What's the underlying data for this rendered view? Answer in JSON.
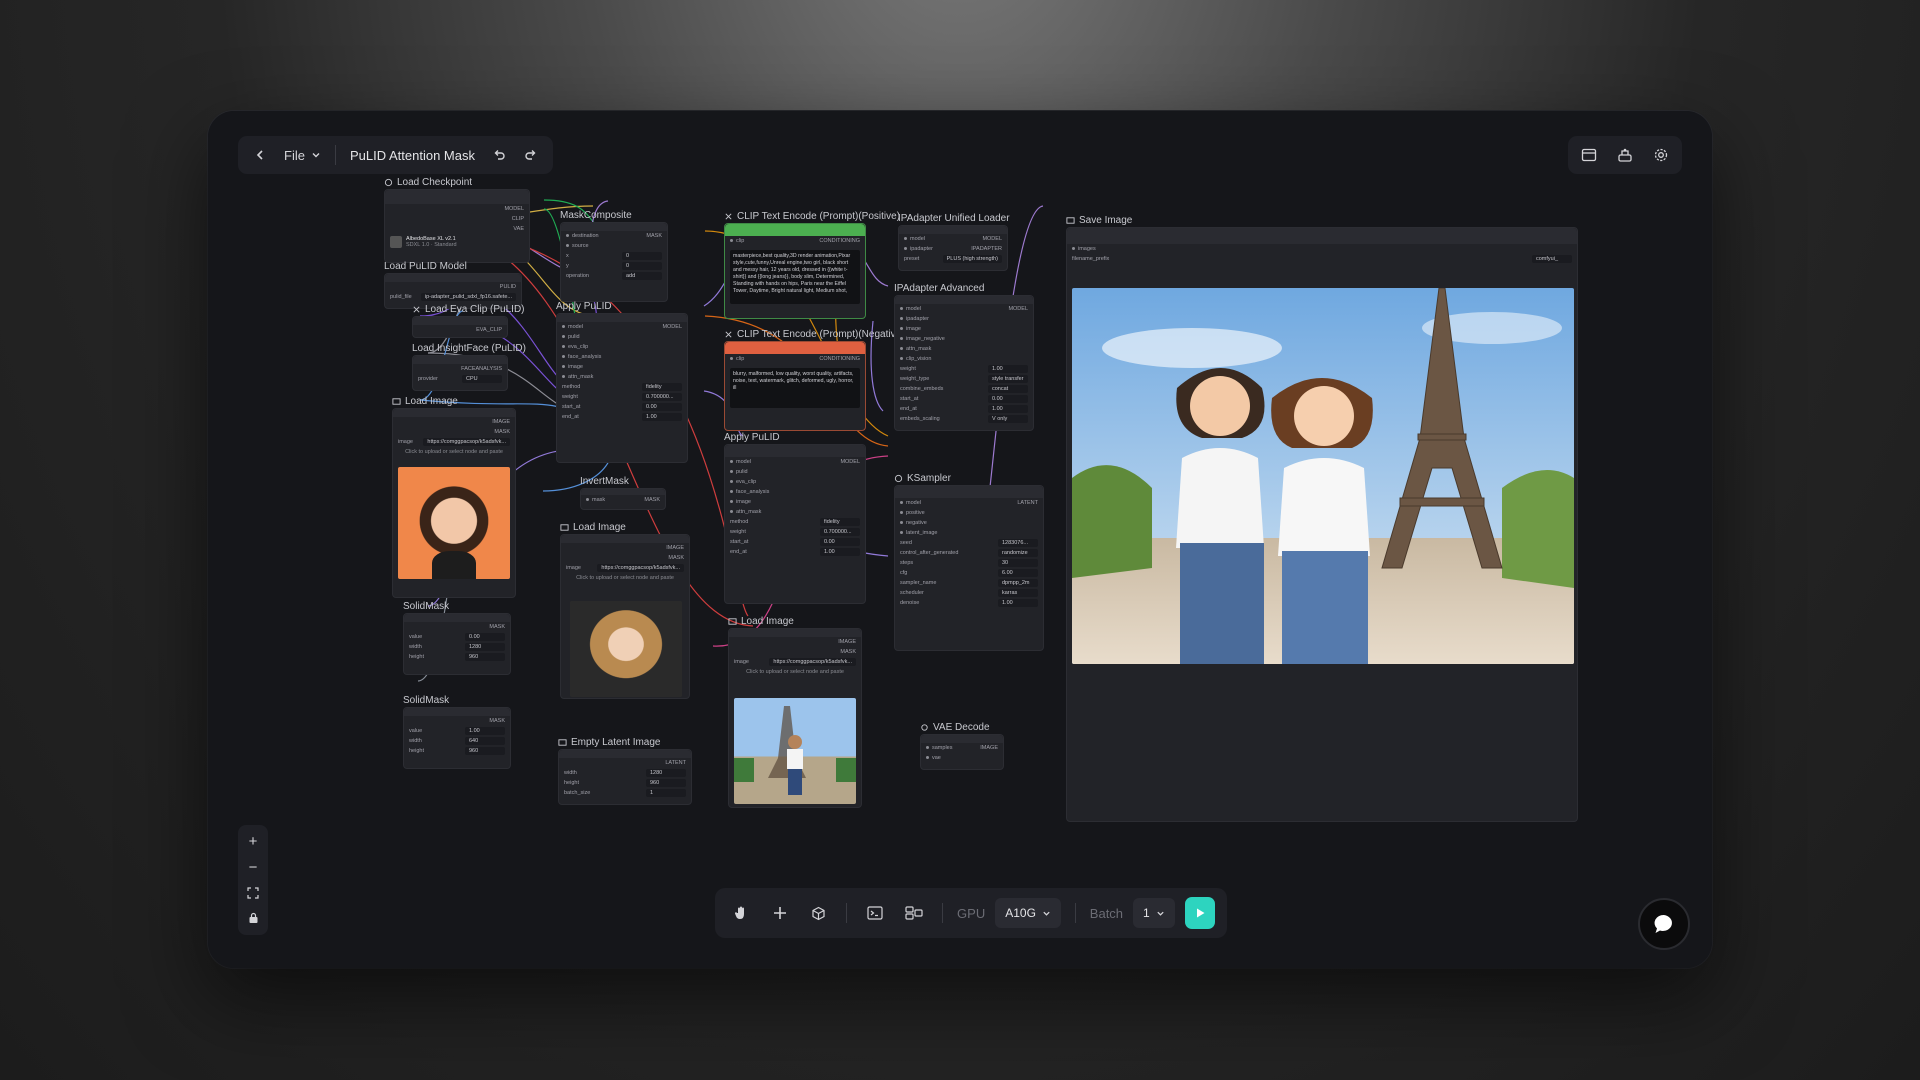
{
  "toolbar": {
    "back_icon": "chevron-left-icon",
    "file_label": "File",
    "workflow_title": "PuLID Attention Mask",
    "undo_icon": "undo-icon",
    "redo_icon": "redo-icon"
  },
  "top_right": {
    "icons": [
      "queue-icon",
      "workflow-icon",
      "settings-icon"
    ]
  },
  "zoom": {
    "zoom_in": "+",
    "zoom_out": "−"
  },
  "bottom_bar": {
    "gpu_label": "GPU",
    "gpu_value": "A10G",
    "batch_label": "Batch",
    "batch_value": "1"
  },
  "nodes": {
    "load_checkpoint": {
      "title": "Load Checkpoint",
      "out_model": "MODEL",
      "out_clip": "CLIP",
      "out_vae": "VAE",
      "ckpt": "AlbedoBase XL v2.1",
      "ckpt_sub": "SDXL 1.0 · Standard"
    },
    "load_pulid_model": {
      "title": "Load PuLID Model",
      "out": "PULID",
      "name_label": "pulid_file",
      "name_value": "ip-adapter_pulid_sdxl_fp16.safete..."
    },
    "load_eva_clip": {
      "title": "Load Eva Clip (PuLID)",
      "out": "EVA_CLIP"
    },
    "load_insightface": {
      "title": "Load InsightFace (PuLID)",
      "out": "FACEANALYSIS",
      "provider_label": "provider",
      "provider_value": "CPU"
    },
    "mask_composite": {
      "title": "MaskComposite",
      "in1": "destination",
      "in2": "source",
      "out": "MASK",
      "x_label": "x",
      "x_value": "0",
      "y_label": "y",
      "y_value": "0",
      "op_label": "operation",
      "op_value": "add"
    },
    "clip_pos": {
      "title": "CLIP Text Encode (Prompt)(Positive)",
      "in": "clip",
      "out": "CONDITIONING",
      "text": "masterpiece,best quality,3D render animation,Pixar style,cute,funny,Unreal engine,two girl, black short and messy hair, 12 years old, dressed in {{white t-shirt}} and {{long jeans}}, body slim, Determined, Standing with hands on hips, Paris near the Eiffel Tower, Daytime, Bright natural light, Medium shot,"
    },
    "clip_neg": {
      "title": "CLIP Text Encode (Prompt)(Negative)",
      "in": "clip",
      "out": "CONDITIONING",
      "text": "blurry, malformed, low quality, worst quality, artifacts, noise, text, watermark, glitch, deformed, ugly, horror, ill"
    },
    "ipadapter_loader": {
      "title": "IPAdapter Unified Loader",
      "in1": "model",
      "in2": "ipadapter",
      "out1": "MODEL",
      "out2": "IPADAPTER",
      "preset_label": "preset",
      "preset_value": "PLUS (high strength)"
    },
    "ipadapter_adv": {
      "title": "IPAdapter Advanced",
      "out": "MODEL",
      "inputs": [
        "model",
        "ipadapter",
        "image",
        "image_negative",
        "attn_mask",
        "clip_vision"
      ],
      "w": [
        [
          "weight",
          "1.00"
        ],
        [
          "weight_type",
          "style transfer"
        ],
        [
          "combine_embeds",
          "concat"
        ],
        [
          "start_at",
          "0.00"
        ],
        [
          "end_at",
          "1.00"
        ],
        [
          "embeds_scaling",
          "V only"
        ]
      ]
    },
    "apply_pulid_1": {
      "title": "Apply PuLID",
      "out": "MODEL",
      "inputs": [
        "model",
        "pulid",
        "eva_clip",
        "face_analysis",
        "image",
        "attn_mask"
      ],
      "w": [
        [
          "method",
          "fidelity"
        ],
        [
          "weight",
          "0.700000..."
        ],
        [
          "start_at",
          "0.00"
        ],
        [
          "end_at",
          "1.00"
        ]
      ]
    },
    "apply_pulid_2": {
      "title": "Apply PuLID",
      "out": "MODEL",
      "inputs": [
        "model",
        "pulid",
        "eva_clip",
        "face_analysis",
        "image",
        "attn_mask"
      ],
      "w": [
        [
          "method",
          "fidelity"
        ],
        [
          "weight",
          "0.700000..."
        ],
        [
          "start_at",
          "0.00"
        ],
        [
          "end_at",
          "1.00"
        ]
      ]
    },
    "invert_mask": {
      "title": "InvertMask",
      "in": "mask",
      "out": "MASK"
    },
    "load_image_1": {
      "title": "Load Image",
      "out1": "IMAGE",
      "out2": "MASK",
      "image_label": "image",
      "image_value": "https://comggpacsop/k5adsfvk...",
      "upload": "Click to upload or select node and paste"
    },
    "load_image_2": {
      "title": "Load Image",
      "out1": "IMAGE",
      "out2": "MASK",
      "image_label": "image",
      "image_value": "https://comggpacsop/k5adsfvk...",
      "upload": "Click to upload or select node and paste"
    },
    "load_image_3": {
      "title": "Load Image",
      "out1": "IMAGE",
      "out2": "MASK",
      "image_label": "image",
      "image_value": "https://comggpacsop/k5adsfvk...",
      "upload": "Click to upload or select node and paste"
    },
    "solid_mask_1": {
      "title": "SolidMask",
      "out": "MASK",
      "w": [
        [
          "value",
          "0.00"
        ],
        [
          "width",
          "1280"
        ],
        [
          "height",
          "960"
        ]
      ]
    },
    "solid_mask_2": {
      "title": "SolidMask",
      "out": "MASK",
      "w": [
        [
          "value",
          "1.00"
        ],
        [
          "width",
          "640"
        ],
        [
          "height",
          "960"
        ]
      ]
    },
    "empty_latent": {
      "title": "Empty Latent Image",
      "out": "LATENT",
      "w": [
        [
          "width",
          "1280"
        ],
        [
          "height",
          "960"
        ],
        [
          "batch_size",
          "1"
        ]
      ]
    },
    "ksampler": {
      "title": "KSampler",
      "out": "LATENT",
      "inputs": [
        "model",
        "positive",
        "negative",
        "latent_image"
      ],
      "w": [
        [
          "seed",
          "1283076..."
        ],
        [
          "control_after_generated",
          "randomize"
        ],
        [
          "steps",
          "30"
        ],
        [
          "cfg",
          "6.00"
        ],
        [
          "sampler_name",
          "dpmpp_2m"
        ],
        [
          "scheduler",
          "karras"
        ],
        [
          "denoise",
          "1.00"
        ]
      ]
    },
    "vae_decode": {
      "title": "VAE Decode",
      "in1": "samples",
      "in2": "vae",
      "out": "IMAGE"
    },
    "save_image": {
      "title": "Save Image",
      "in": "images",
      "prefix_label": "filename_prefix",
      "prefix_value": "comfyui_"
    }
  },
  "colors": {
    "accent": "#2dd4bf",
    "positive_header": "#4caf50",
    "negative_header": "#e06040",
    "canvas": "#15161a",
    "node": "#222328"
  }
}
